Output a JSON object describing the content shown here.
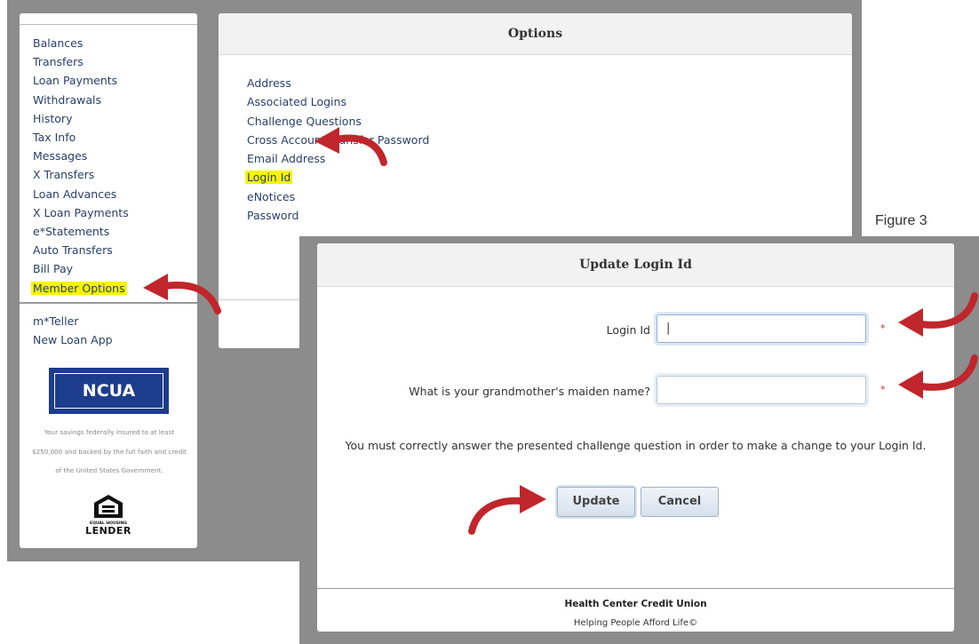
{
  "sidebar": {
    "menu": [
      {
        "label": "Balances"
      },
      {
        "label": "Transfers"
      },
      {
        "label": "Loan Payments"
      },
      {
        "label": "Withdrawals"
      },
      {
        "label": "History"
      },
      {
        "label": "Tax Info"
      },
      {
        "label": "Messages"
      },
      {
        "label": "X Transfers"
      },
      {
        "label": "Loan Advances"
      },
      {
        "label": "X Loan Payments"
      },
      {
        "label": "e*Statements"
      },
      {
        "label": "Auto Transfers"
      },
      {
        "label": "Bill Pay"
      },
      {
        "label": "Member Options",
        "highlighted": true
      }
    ],
    "menu2": [
      {
        "label": "m*Teller"
      },
      {
        "label": "New Loan App"
      }
    ],
    "ncua": {
      "logo_text": "NCUA",
      "note_lines": [
        "Your savings federally insured to at least",
        "$250,000 and backed by the full faith and credit",
        "of the United States Government."
      ]
    },
    "equal_housing": {
      "small": "EQUAL HOUSING",
      "big": "LENDER"
    }
  },
  "options": {
    "title": "Options",
    "items": [
      {
        "label": "Address"
      },
      {
        "label": "Associated Logins"
      },
      {
        "label": "Challenge Questions"
      },
      {
        "label": "Cross Account Transfer Password"
      },
      {
        "label": "Email Address"
      },
      {
        "label": "Login Id",
        "highlighted": true
      },
      {
        "label": "eNotices"
      },
      {
        "label": "Password"
      }
    ]
  },
  "figure_label": "Figure 3",
  "dialog": {
    "title": "Update Login Id",
    "login_label": "Login Id",
    "login_value": "|",
    "question_label": "What is your grandmother's maiden name?",
    "question_value": "",
    "required_mark": "*",
    "note": "You must correctly answer the presented challenge question in order to make a change to your Login Id.",
    "update_label": "Update",
    "cancel_label": "Cancel",
    "footer_org": "Health Center Credit Union",
    "footer_tagline": "Helping People Afford Life©"
  },
  "colors": {
    "link": "#2a3f6b",
    "highlight": "#f5f500",
    "arrow": "#c0262b",
    "ncua_blue": "#1d3c8c",
    "backdrop": "#8c8c8c"
  },
  "icons": [
    "red-curved-arrow-icon",
    "equal-housing-lender-icon",
    "ncua-logo"
  ]
}
